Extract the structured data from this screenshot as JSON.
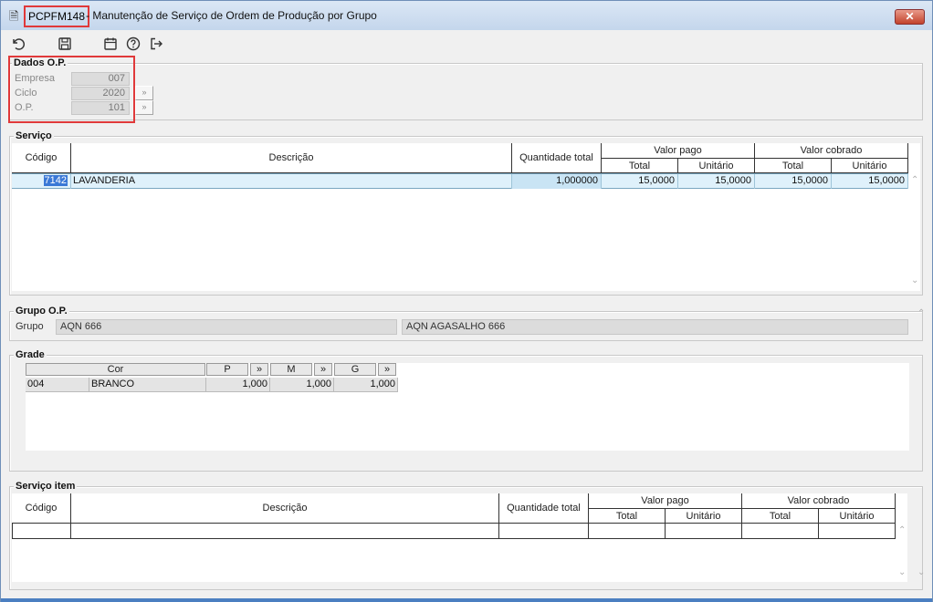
{
  "window": {
    "code": "PCPFM148",
    "title": " - Manutenção de Serviço de Ordem de Produção por Grupo",
    "close_glyph": "✕"
  },
  "toolbar": {
    "icons": [
      "undo-icon",
      "save-icon",
      "calendar-icon",
      "help-icon",
      "exit-icon"
    ]
  },
  "dados_op": {
    "title": "Dados O.P.",
    "empresa_label": "Empresa",
    "empresa_value": "007",
    "ciclo_label": "Ciclo",
    "ciclo_value": "2020",
    "op_label": "O.P.",
    "op_value": "101",
    "lookup_glyph": "»"
  },
  "servico": {
    "title": "Serviço",
    "headers": {
      "codigo": "Código",
      "descricao": "Descrição",
      "quantidade_total": "Quantidade total",
      "valor_pago": "Valor pago",
      "valor_cobrado": "Valor cobrado",
      "total": "Total",
      "unitario": "Unitário"
    },
    "rows": [
      {
        "codigo": "7142",
        "descricao": "LAVANDERIA",
        "quantidade_total": "1,000000",
        "pago_total": "15,0000",
        "pago_unitario": "15,0000",
        "cobrado_total": "15,0000",
        "cobrado_unitario": "15,0000"
      }
    ]
  },
  "grupo_op": {
    "title": "Grupo O.P.",
    "grupo_label": "Grupo",
    "grupo_code": "AQN 666",
    "grupo_desc": "AQN AGASALHO 666"
  },
  "grade": {
    "title": "Grade",
    "cor_header": "Cor",
    "sizes": [
      "P",
      "M",
      "G"
    ],
    "expand_glyph": "»",
    "rows": [
      {
        "cor_code": "004",
        "cor_name": "BRANCO",
        "values": [
          "1,000",
          "1,000",
          "1,000"
        ]
      }
    ]
  },
  "servico_item": {
    "title": "Serviço item",
    "headers": {
      "codigo": "Código",
      "descricao": "Descrição",
      "quantidade_total": "Quantidade total",
      "valor_pago": "Valor pago",
      "valor_cobrado": "Valor cobrado",
      "total": "Total",
      "unitario": "Unitário"
    }
  },
  "colors": {
    "highlight_red": "#e0393a",
    "selected_row": "#dff1fb",
    "selected_text": "#3a78d6"
  }
}
